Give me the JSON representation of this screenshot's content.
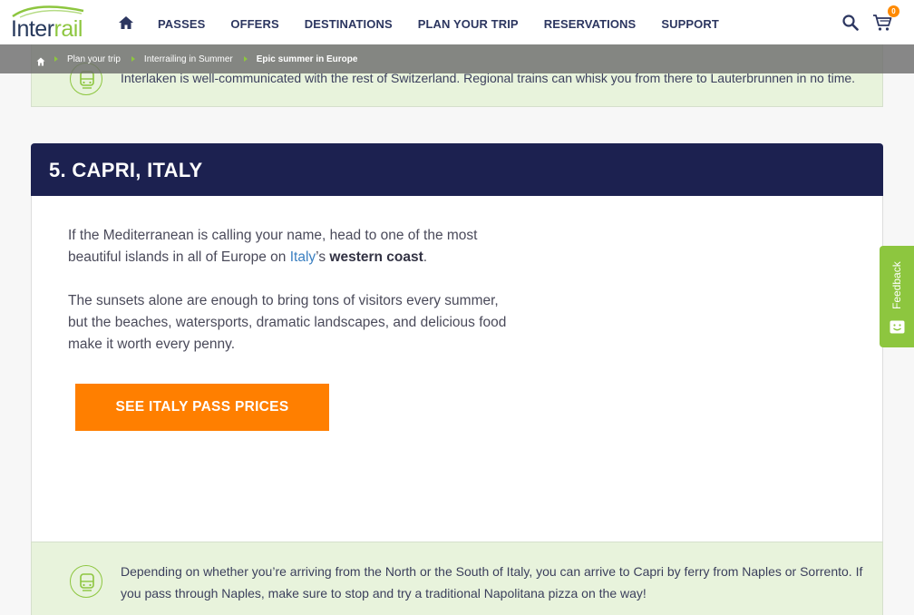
{
  "header": {
    "logo_inter": "Inter",
    "logo_rail": "rail",
    "nav": [
      "PASSES",
      "OFFERS",
      "DESTINATIONS",
      "PLAN YOUR TRIP",
      "RESERVATIONS",
      "SUPPORT"
    ],
    "cart_count": "0"
  },
  "breadcrumb": {
    "items": [
      "Plan your trip",
      "Interrailing in Summer",
      "Epic summer in Europe"
    ]
  },
  "info_top": {
    "text": "Interlaken is well-communicated with the rest of Switzerland. Regional trains can whisk you from there to Lauterbrunnen in no time."
  },
  "section": {
    "title": "5. CAPRI, ITALY",
    "para1_a": "If the Mediterranean is calling your name, head to one of the most beautiful islands in all of Europe on ",
    "para1_link": "Italy",
    "para1_b": "’s ",
    "para1_bold": "western coast",
    "para1_c": ".",
    "para2": "The sunsets alone are enough to bring tons of visitors every summer, but the beaches, watersports, dramatic landscapes, and delicious food make it worth every penny.",
    "cta": "SEE ITALY PASS PRICES"
  },
  "info_bottom": {
    "text": "Depending on whether you’re arriving from the North or the South of Italy, you can arrive to Capri by ferry from Naples or Sorrento. If you pass through Naples, make sure to stop and try a traditional Napolitana pizza on the way!"
  },
  "feedback": {
    "label": "Feedback"
  },
  "colors": {
    "brand_navy": "#1c2150",
    "brand_green": "#8dc63f",
    "cta_orange": "#ff7f00",
    "info_bg": "#e8f3dc"
  }
}
